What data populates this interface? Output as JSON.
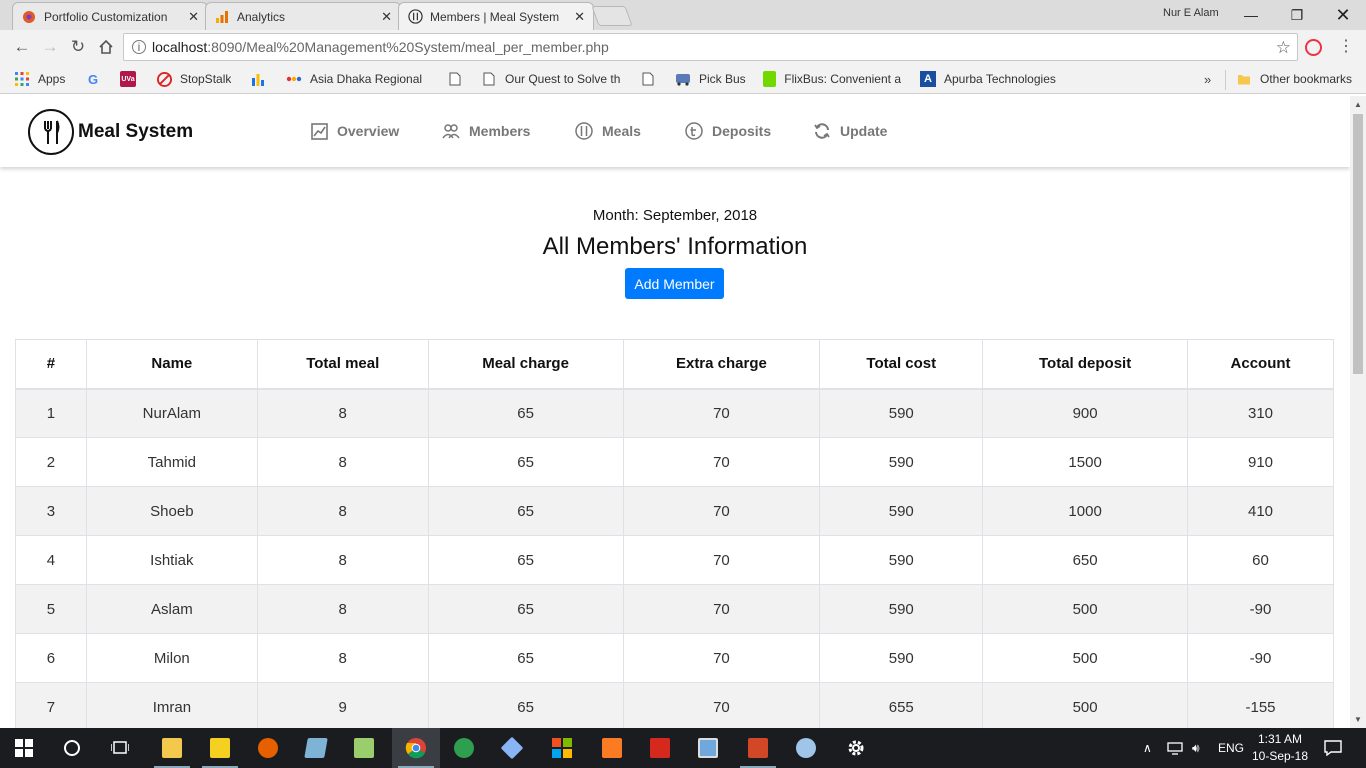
{
  "browser": {
    "tabs": [
      {
        "title": "Portfolio Customization",
        "icon": "portfolio-favicon",
        "active": false
      },
      {
        "title": "Analytics",
        "icon": "analytics-favicon",
        "active": false
      },
      {
        "title": "Members | Meal System",
        "icon": "meal-system-favicon",
        "active": true
      }
    ],
    "profile_name": "Nur E Alam",
    "address_host": "localhost",
    "address_path": ":8090/Meal%20Management%20System/meal_per_member.php",
    "bookmarks": [
      {
        "label": "Apps",
        "icon": "apps-grid-icon"
      },
      {
        "label": "",
        "icon": "google-icon"
      },
      {
        "label": "",
        "icon": "uva-icon"
      },
      {
        "label": "StopStalk",
        "icon": "stopstalk-icon"
      },
      {
        "label": "",
        "icon": "chart-bars-icon"
      },
      {
        "label": "Asia Dhaka Regional",
        "icon": "asia-dhaka-icon"
      },
      {
        "label": "",
        "icon": "page-icon"
      },
      {
        "label": "Our Quest to Solve th",
        "icon": "page-icon"
      },
      {
        "label": "",
        "icon": "page-icon"
      },
      {
        "label": "Pick Bus",
        "icon": "bus-icon"
      },
      {
        "label": "FlixBus: Convenient a",
        "icon": "flixbus-icon"
      },
      {
        "label": "Apurba Technologies",
        "icon": "apurba-icon"
      }
    ],
    "bookmarks_more": "»",
    "other_bookmarks": "Other bookmarks"
  },
  "app": {
    "brand": "Meal System",
    "nav": [
      {
        "label": "Overview",
        "icon": "overview-chart-icon"
      },
      {
        "label": "Members",
        "icon": "members-group-icon"
      },
      {
        "label": "Meals",
        "icon": "meals-utensils-icon"
      },
      {
        "label": "Deposits",
        "icon": "deposits-taka-icon"
      },
      {
        "label": "Update",
        "icon": "update-refresh-icon"
      }
    ],
    "month_label": "Month: September, 2018",
    "heading": "All Members' Information",
    "add_button": "Add Member"
  },
  "table": {
    "columns": [
      "#",
      "Name",
      "Total meal",
      "Meal charge",
      "Extra charge",
      "Total cost",
      "Total deposit",
      "Account"
    ],
    "rows": [
      {
        "num": "1",
        "name": "NurAlam",
        "total_meal": "8",
        "meal_charge": "65",
        "extra_charge": "70",
        "total_cost": "590",
        "total_deposit": "900",
        "account": "310",
        "account_negative": false
      },
      {
        "num": "2",
        "name": "Tahmid",
        "total_meal": "8",
        "meal_charge": "65",
        "extra_charge": "70",
        "total_cost": "590",
        "total_deposit": "1500",
        "account": "910",
        "account_negative": false
      },
      {
        "num": "3",
        "name": "Shoeb",
        "total_meal": "8",
        "meal_charge": "65",
        "extra_charge": "70",
        "total_cost": "590",
        "total_deposit": "1000",
        "account": "410",
        "account_negative": false
      },
      {
        "num": "4",
        "name": "Ishtiak",
        "total_meal": "8",
        "meal_charge": "65",
        "extra_charge": "70",
        "total_cost": "590",
        "total_deposit": "650",
        "account": "60",
        "account_negative": true
      },
      {
        "num": "5",
        "name": "Aslam",
        "total_meal": "8",
        "meal_charge": "65",
        "extra_charge": "70",
        "total_cost": "590",
        "total_deposit": "500",
        "account": "-90",
        "account_negative": true
      },
      {
        "num": "6",
        "name": "Milon",
        "total_meal": "8",
        "meal_charge": "65",
        "extra_charge": "70",
        "total_cost": "590",
        "total_deposit": "500",
        "account": "-90",
        "account_negative": true
      },
      {
        "num": "7",
        "name": "Imran",
        "total_meal": "9",
        "meal_charge": "65",
        "extra_charge": "70",
        "total_cost": "655",
        "total_deposit": "500",
        "account": "-155",
        "account_negative": true
      }
    ]
  },
  "taskbar": {
    "language": "ENG",
    "time": "1:31 AM",
    "date": "10-Sep-18"
  },
  "colors": {
    "primary_button": "#007bff",
    "negative_account": "#e3342f",
    "nav_text": "#777777"
  }
}
